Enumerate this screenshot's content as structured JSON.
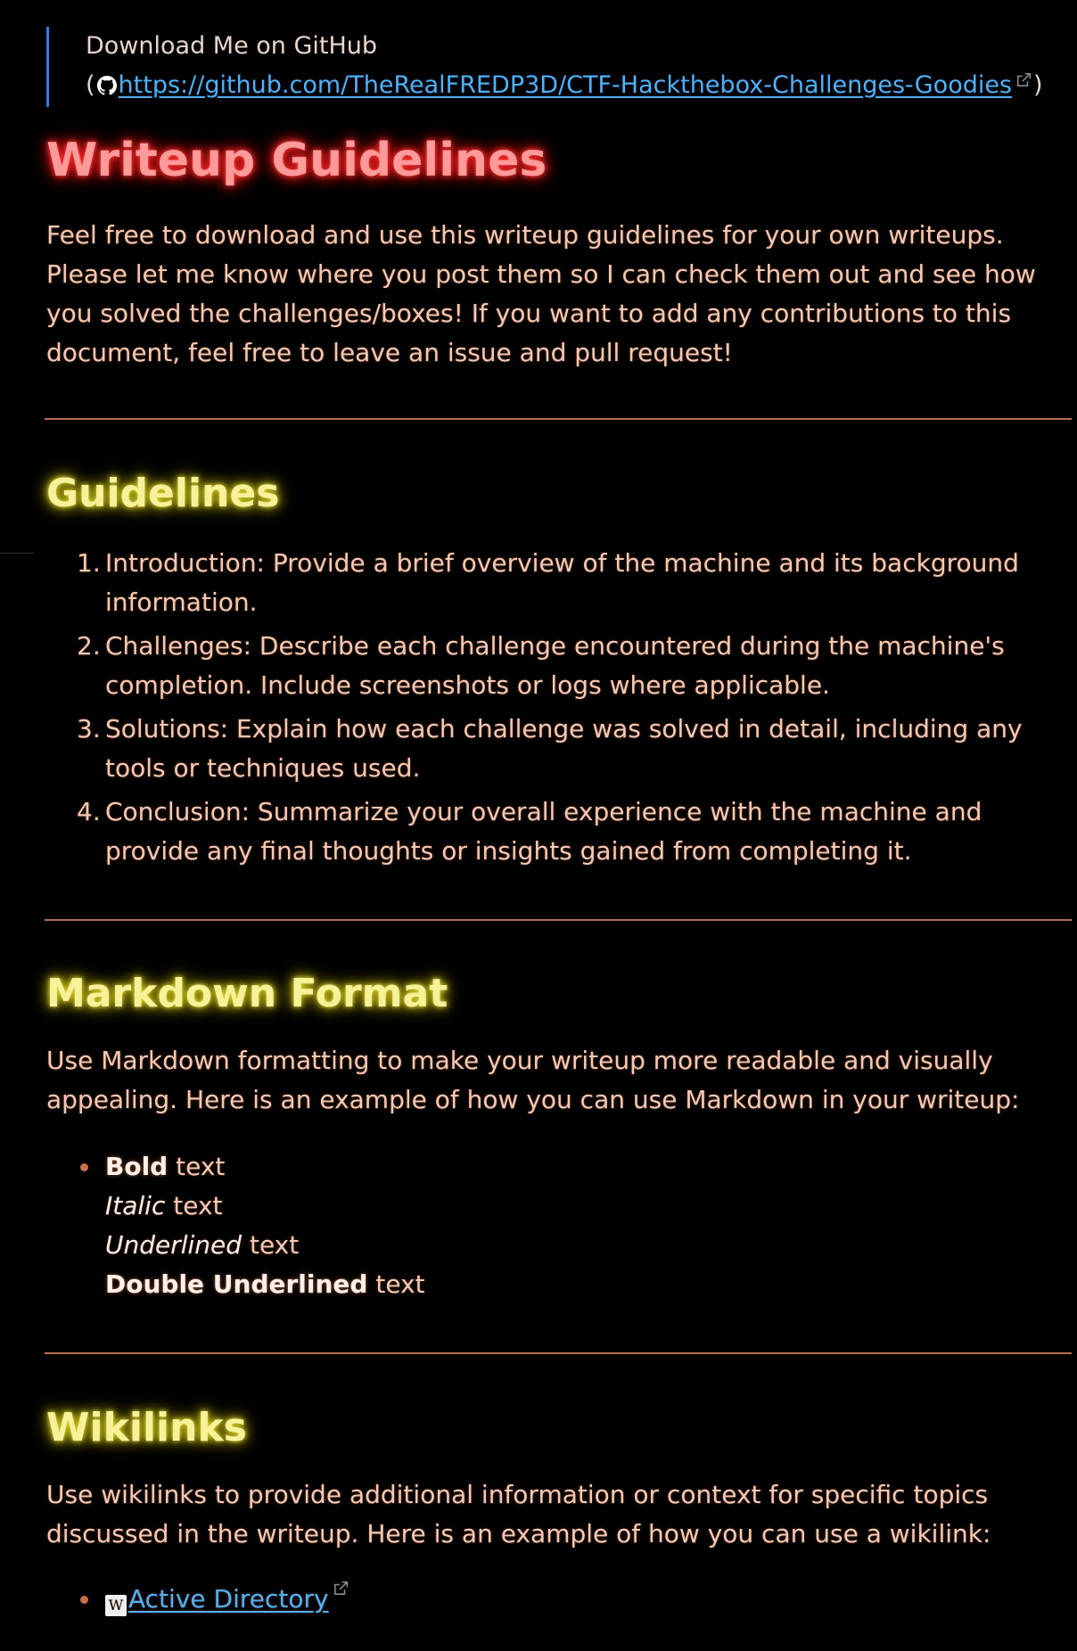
{
  "callout": {
    "line1": "Download Me on GitHub",
    "open_paren": "(",
    "github_icon": "github-icon",
    "link_text": "https://github.com/TheRealFREDP3D/CTF-Hackthebox-Challenges-Goodies",
    "close_paren": ")"
  },
  "title": "Writeup Guidelines",
  "intro": "Feel free to download and use this writeup guidelines for your own writeups. Please let me know where you post them so I can check them out and see how you solved the challenges/boxes! If you want to add any contributions to this document, feel free to leave an issue and pull request!",
  "guidelines": {
    "heading": "Guidelines",
    "items": [
      {
        "num": "1.",
        "text": "Introduction: Provide a brief overview of the machine and its background information."
      },
      {
        "num": "2.",
        "text": "Challenges: Describe each challenge encountered during the machine's completion. Include screenshots or logs where applicable."
      },
      {
        "num": "3.",
        "text": "Solutions: Explain how each challenge was solved in detail, including any tools or techniques used."
      },
      {
        "num": "4.",
        "text": "Conclusion: Summarize your overall experience with the machine and provide any final thoughts or insights gained from completing it."
      }
    ]
  },
  "markdown": {
    "heading": "Markdown Format",
    "intro": "Use Markdown formatting to make your writeup more readable and visually appealing. Here is an example of how you can use Markdown in your writeup:",
    "examples": [
      {
        "styled": "Bold",
        "rest": " text"
      },
      {
        "styled": "Italic",
        "rest": " text"
      },
      {
        "styled": "Underlined",
        "rest": " text"
      },
      {
        "styled": "Double Underlined",
        "rest": " text"
      }
    ]
  },
  "wikilinks": {
    "heading": "Wikilinks",
    "intro": "Use wikilinks to provide additional information or context for specific topics discussed in the writeup. Here is an example of how you can use a wikilink:",
    "wiki_icon_glyph": "W",
    "link_text": "Active Directory"
  },
  "colors": {
    "background": "#000000",
    "body_text": "#f4c9b3",
    "title": "#ff9a9a",
    "section_heading": "#f6f29a",
    "link": "#4fb2ff",
    "callout_border": "#2f7fd4",
    "rule": "#b86f4e"
  }
}
